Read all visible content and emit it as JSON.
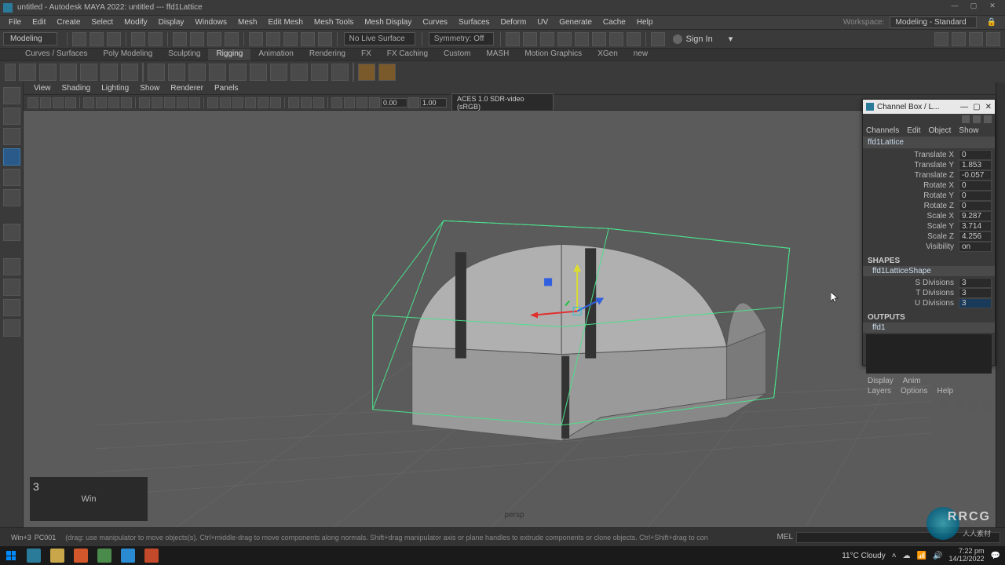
{
  "title": "untitled - Autodesk MAYA 2022: untitled --- ffd1Lattice",
  "menus": [
    "File",
    "Edit",
    "Create",
    "Select",
    "Modify",
    "Display",
    "Windows",
    "Mesh",
    "Edit Mesh",
    "Mesh Tools",
    "Mesh Display",
    "Curves",
    "Surfaces",
    "Deform",
    "UV",
    "Generate",
    "Cache",
    "Help"
  ],
  "workspace_label": "Workspace:",
  "workspace_value": "Modeling - Standard",
  "mode_dropdown": "Modeling",
  "live_surface": "No Live Surface",
  "symmetry": "Symmetry: Off",
  "signin": "Sign In",
  "shelf_tabs": [
    "Curves / Surfaces",
    "Poly Modeling",
    "Sculpting",
    "Rigging",
    "Animation",
    "Rendering",
    "FX",
    "FX Caching",
    "Custom",
    "MASH",
    "Motion Graphics",
    "XGen",
    "new"
  ],
  "shelf_active": "Rigging",
  "vp_menus": [
    "View",
    "Shading",
    "Lighting",
    "Show",
    "Renderer",
    "Panels"
  ],
  "vp_num1": "0.00",
  "vp_num2": "1.00",
  "vp_colorspace": "ACES 1.0 SDR-video (sRGB)",
  "persp_label": "persp",
  "hint_key": "3",
  "hint_hotkey": "Win",
  "hint_user": "Win+3",
  "hint_pc": "PC001",
  "status_text": "(drag: use manipulator to move objects(s). Ctrl+middle-drag to move components along normals. Shift+drag manipulator axis or plane handles to extrude components or clone objects. Ctrl+Shift+drag to con",
  "mel_label": "MEL",
  "channelbox": {
    "title": "Channel Box / L...",
    "menus": [
      "Channels",
      "Edit",
      "Object",
      "Show"
    ],
    "object": "ffd1Lattice",
    "attrs": [
      {
        "label": "Translate X",
        "val": "0"
      },
      {
        "label": "Translate Y",
        "val": "1.853"
      },
      {
        "label": "Translate Z",
        "val": "-0.057"
      },
      {
        "label": "Rotate X",
        "val": "0"
      },
      {
        "label": "Rotate Y",
        "val": "0"
      },
      {
        "label": "Rotate Z",
        "val": "0"
      },
      {
        "label": "Scale X",
        "val": "9.287"
      },
      {
        "label": "Scale Y",
        "val": "3.714"
      },
      {
        "label": "Scale Z",
        "val": "4.256"
      },
      {
        "label": "Visibility",
        "val": "on"
      }
    ],
    "shapes_header": "SHAPES",
    "shape_name": "ffd1LatticeShape",
    "shape_attrs": [
      {
        "label": "S Divisions",
        "val": "3"
      },
      {
        "label": "T Divisions",
        "val": "3"
      },
      {
        "label": "U Divisions",
        "val": "3"
      }
    ],
    "outputs_header": "OUTPUTS",
    "output_name": "ffd1",
    "bottom1": [
      "Display",
      "Anim"
    ],
    "bottom2": [
      "Layers",
      "Options",
      "Help"
    ]
  },
  "weather": "11°C  Cloudy",
  "time": "7:22 pm",
  "date": "14/12/2022",
  "watermark": {
    "t1": "RRCG",
    "t2": "人人素材"
  }
}
